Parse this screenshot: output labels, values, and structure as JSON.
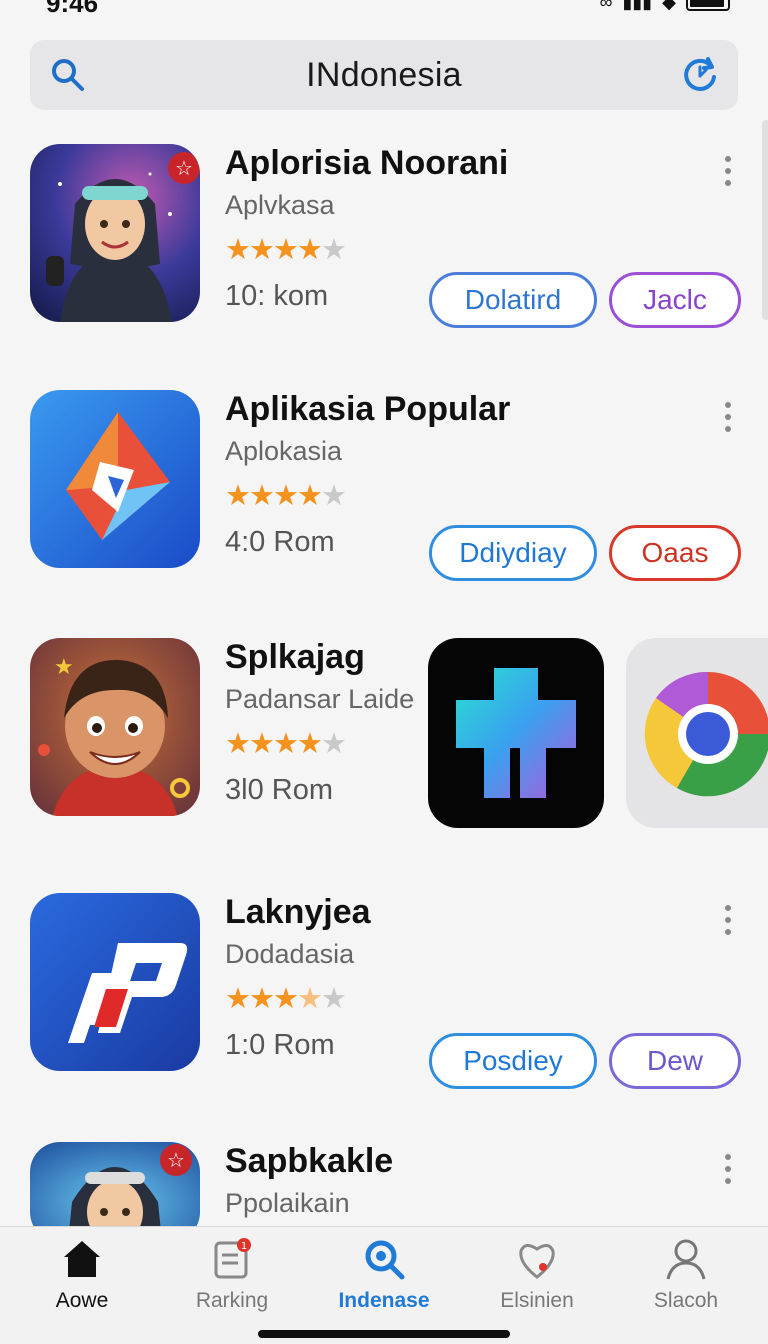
{
  "status_bar": {
    "time": "9:46"
  },
  "search": {
    "title": "INdonesia"
  },
  "apps": [
    {
      "name": "Aplorisia Noorani",
      "category": "Aplvkasa",
      "rating": 4,
      "size": "10: kom",
      "buttons": [
        {
          "label": "Dolatird",
          "color": "#4a7ed8"
        },
        {
          "label": "Jaclc",
          "color": "#9b4fd6"
        }
      ]
    },
    {
      "name": "Aplikasia Popular",
      "category": "Aplokasia",
      "rating": 4,
      "size": "4:0 Rom",
      "buttons": [
        {
          "label": "Ddiydiay",
          "color": "#2f8ee0"
        },
        {
          "label": "Oaas",
          "color": "#d8392a"
        }
      ]
    },
    {
      "name": "Splkajag",
      "category": "Padansar Laide",
      "rating": 4,
      "size": "3l0 Rom",
      "buttons": []
    },
    {
      "name": "Laknyjea",
      "category": "Dodadasia",
      "rating": 3.5,
      "size": "1:0 Rom",
      "buttons": [
        {
          "label": "Posdiey",
          "color": "#2f8ee0"
        },
        {
          "label": "Dew",
          "color": "#7a68d8"
        }
      ]
    },
    {
      "name": "Sapbkakle",
      "category": "Ppolaikain",
      "rating": 0,
      "size": "",
      "buttons": []
    }
  ],
  "tabs": [
    {
      "label": "Aowe",
      "icon": "home-icon"
    },
    {
      "label": "Rarking",
      "icon": "ranking-icon"
    },
    {
      "label": "Indenase",
      "icon": "search-icon"
    },
    {
      "label": "Elsinien",
      "icon": "heart-search-icon"
    },
    {
      "label": "Slacoh",
      "icon": "profile-icon"
    }
  ],
  "colors": {
    "accent": "#1f7ad8",
    "star": "#f5921e",
    "background": "#f5f5f5"
  }
}
